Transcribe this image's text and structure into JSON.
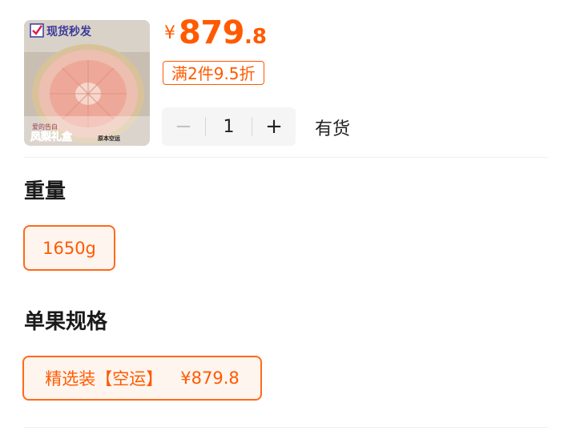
{
  "product": {
    "thumbnail": {
      "badge_text": "现货秒发",
      "tagline": "爱的告白",
      "caption": "凤梨礼盒",
      "sub_caption": "原本空运"
    },
    "price": {
      "currency": "¥",
      "integer": "879",
      "decimal": ".8"
    },
    "promo_label": "满2件9.5折",
    "quantity": {
      "minus": "−",
      "value": "1",
      "plus": "+"
    },
    "stock_status": "有货"
  },
  "specs": [
    {
      "title": "重量",
      "options": [
        {
          "label": "1650g",
          "selected": true
        }
      ]
    },
    {
      "title": "单果规格",
      "options": [
        {
          "label": "精选装【空运】",
          "price": "¥879.8",
          "selected": true
        }
      ]
    }
  ],
  "colors": {
    "accent": "#ff5a00",
    "selected_bg": "#fff5ef"
  }
}
